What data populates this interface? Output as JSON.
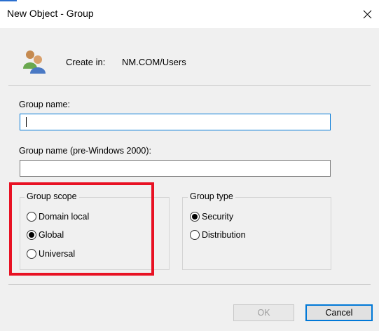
{
  "window": {
    "title": "New Object - Group",
    "close_icon": "close-icon"
  },
  "header": {
    "icon": "group-users-icon",
    "create_in_label": "Create in:",
    "create_in_value": "NM.COM/Users"
  },
  "fields": {
    "group_name_label": "Group name:",
    "group_name_value": "",
    "pre2000_label": "Group name (pre-Windows 2000):",
    "pre2000_value": ""
  },
  "group_scope": {
    "title": "Group scope",
    "options": [
      "Domain local",
      "Global",
      "Universal"
    ],
    "selected": "Global"
  },
  "group_type": {
    "title": "Group type",
    "options": [
      "Security",
      "Distribution"
    ],
    "selected": "Security"
  },
  "buttons": {
    "ok_label": "OK",
    "ok_enabled": false,
    "cancel_label": "Cancel"
  },
  "colors": {
    "highlight": "#e81123",
    "accent": "#0078d7"
  }
}
